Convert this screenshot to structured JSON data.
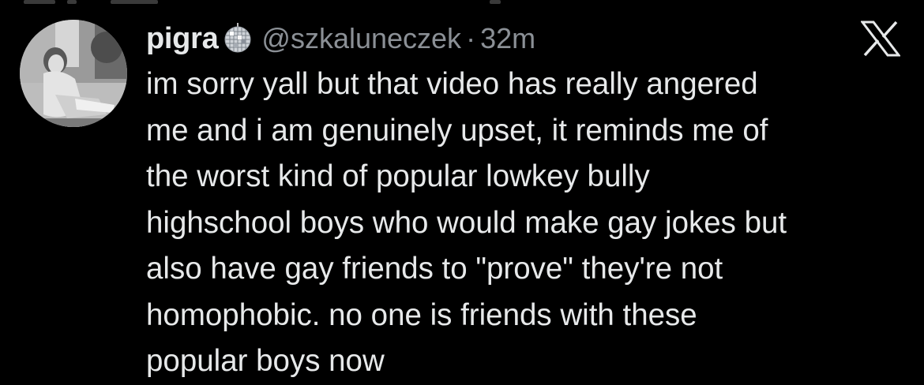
{
  "tweet": {
    "display_name": "pigra",
    "name_emoji": "disco-ball-icon",
    "handle": "@szkaluneczek",
    "separator": "·",
    "time": "32m",
    "platform_icon": "x-logo-icon",
    "lines": [
      "im sorry yall but that video has really angered",
      "me and i am genuinely upset, it reminds me of",
      "the worst kind of popular lowkey bully",
      "highschool boys who would make gay jokes but",
      "also have gay friends to \"prove\" they're not",
      "homophobic. no one is friends with these",
      "popular boys now"
    ]
  },
  "colors": {
    "background": "#000000",
    "primary_text": "#e7e9ea",
    "secondary_text": "#8b9096"
  }
}
